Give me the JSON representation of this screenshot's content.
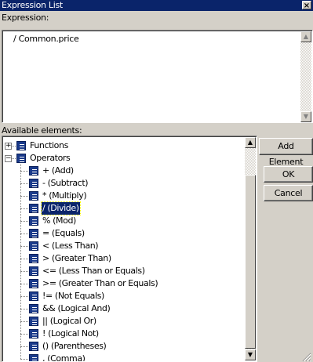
{
  "window": {
    "title": "Expression List",
    "close_glyph": "×"
  },
  "expression": {
    "label": "Expression:",
    "value": "/ Common.price"
  },
  "elements": {
    "label": "Available elements:",
    "tree": [
      {
        "label": "Functions",
        "expander": "+",
        "level": 0,
        "selected": false
      },
      {
        "label": "Operators",
        "expander": "−",
        "level": 0,
        "selected": false
      },
      {
        "label": "+ (Add)",
        "level": 1,
        "selected": false
      },
      {
        "label": "- (Subtract)",
        "level": 1,
        "selected": false
      },
      {
        "label": "* (Multiply)",
        "level": 1,
        "selected": false
      },
      {
        "label": "/ (Divide)",
        "level": 1,
        "selected": true
      },
      {
        "label": "% (Mod)",
        "level": 1,
        "selected": false
      },
      {
        "label": "= (Equals)",
        "level": 1,
        "selected": false
      },
      {
        "label": "< (Less Than)",
        "level": 1,
        "selected": false
      },
      {
        "label": "> (Greater Than)",
        "level": 1,
        "selected": false
      },
      {
        "label": "<= (Less Than or Equals)",
        "level": 1,
        "selected": false
      },
      {
        "label": ">= (Greater Than or Equals)",
        "level": 1,
        "selected": false
      },
      {
        "label": "!= (Not Equals)",
        "level": 1,
        "selected": false
      },
      {
        "label": "&& (Logical And)",
        "level": 1,
        "selected": false
      },
      {
        "label": "|| (Logical Or)",
        "level": 1,
        "selected": false
      },
      {
        "label": "! (Logical Not)",
        "level": 1,
        "selected": false
      },
      {
        "label": "() (Parentheses)",
        "level": 1,
        "selected": false
      },
      {
        "label": ", (Comma)",
        "level": 1,
        "selected": false
      }
    ]
  },
  "buttons": {
    "add_element": "Add Element",
    "ok": "OK",
    "cancel": "Cancel"
  },
  "scroll": {
    "up_glyph": "▲",
    "down_glyph": "▼"
  }
}
